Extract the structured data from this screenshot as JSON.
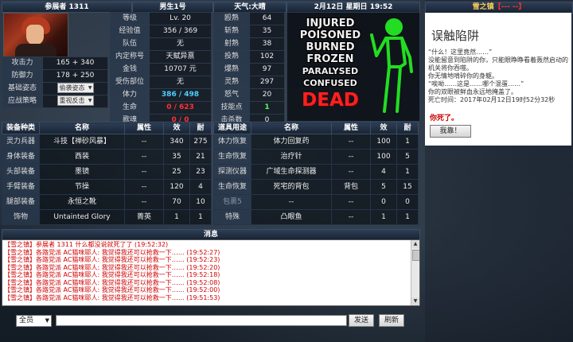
{
  "header": {
    "player": "参展者 1311",
    "server": "男生1号",
    "weather": "天气:大晴",
    "datetime": "2月12日 星期日 19:52"
  },
  "left_stats": [
    {
      "label": "攻击力",
      "value": "165 + 340"
    },
    {
      "label": "防御力",
      "value": "178 + 250"
    }
  ],
  "stance": {
    "label": "基础姿态",
    "value": "偷袭姿态"
  },
  "strategy": {
    "label": "应战策略",
    "value": "重视反击"
  },
  "stats_a": [
    {
      "label": "等级",
      "value": "Lv. 20"
    },
    {
      "label": "经验值",
      "value": "356 / 369"
    },
    {
      "label": "队伍",
      "value": "无"
    },
    {
      "label": "内定称号",
      "value": "天赋异禀"
    },
    {
      "label": "金钱",
      "value": "10707 元"
    },
    {
      "label": "受伤部位",
      "value": "无"
    },
    {
      "label": "体力",
      "value": "386 / 498",
      "style": "cyan"
    },
    {
      "label": "生命",
      "value": "0 / 623",
      "style": "red"
    },
    {
      "label": "歌魂",
      "value": "0 / 0",
      "style": "red"
    }
  ],
  "stats_b": [
    {
      "label": "殴熟",
      "value": "64"
    },
    {
      "label": "斩熟",
      "value": "35"
    },
    {
      "label": "射熟",
      "value": "38"
    },
    {
      "label": "投熟",
      "value": "102"
    },
    {
      "label": "爆熟",
      "value": "97"
    },
    {
      "label": "灵熟",
      "value": "297"
    },
    {
      "label": "怒气",
      "value": "20"
    },
    {
      "label": "技能点",
      "value": "1",
      "style": "green"
    },
    {
      "label": "击杀数",
      "value": "0"
    }
  ],
  "status_words": [
    "INJURED",
    "POISONED",
    "BURNED",
    "FROZEN",
    "PARALYSED",
    "CONFUSED"
  ],
  "dead_word": "DEAD",
  "equipment": {
    "headers": [
      "装备种类",
      "名称",
      "属性",
      "效",
      "耐"
    ],
    "rows": [
      {
        "cat": "灵力兵器",
        "name": "斗技【禅砂风暴】",
        "attr": "--",
        "eff": "340",
        "dur": "275"
      },
      {
        "cat": "身体装备",
        "name": "西装",
        "attr": "--",
        "eff": "35",
        "dur": "21"
      },
      {
        "cat": "头部装备",
        "name": "墨镜",
        "attr": "--",
        "eff": "25",
        "dur": "23"
      },
      {
        "cat": "手臂装备",
        "name": "节操",
        "attr": "--",
        "eff": "120",
        "dur": "4"
      },
      {
        "cat": "腿部装备",
        "name": "永恒之靴",
        "attr": "--",
        "eff": "70",
        "dur": "10"
      },
      {
        "cat": "饰物",
        "name": "Untainted Glory",
        "attr": "菁英",
        "eff": "1",
        "dur": "1"
      }
    ]
  },
  "items": {
    "headers": [
      "道具用途",
      "名称",
      "属性",
      "效",
      "耐"
    ],
    "rows": [
      {
        "cat": "体力恢复",
        "name": "体力回复药",
        "attr": "--",
        "eff": "100",
        "dur": "1",
        "dim": false
      },
      {
        "cat": "生命恢复",
        "name": "治疗针",
        "attr": "--",
        "eff": "100",
        "dur": "5",
        "dim": false
      },
      {
        "cat": "探测仪器",
        "name": "广域生命探测器",
        "attr": "--",
        "eff": "4",
        "dur": "1",
        "dim": false
      },
      {
        "cat": "生命恢复",
        "name": "死宅的背包",
        "attr": "背包",
        "eff": "5",
        "dur": "15",
        "dim": false
      },
      {
        "cat": "包裹5",
        "name": "--",
        "attr": "--",
        "eff": "0",
        "dur": "0",
        "dim": true
      },
      {
        "cat": "特殊",
        "name": "凸眼鱼",
        "attr": "--",
        "eff": "1",
        "dur": "1",
        "dim": false
      }
    ]
  },
  "messages": {
    "title": "消息",
    "lines": [
      {
        "text": "【雪之镇】参展者 1311 什么都没说就死了了 (19:52:32)"
      },
      {
        "text": "【雪之镇】各路党派 AC猫咪耶人: 我觉得我还可以抢救一下…… (19:52:27)"
      },
      {
        "text": "【雪之镇】各路党派 AC猫咪耶人: 我觉得我还可以抢救一下…… (19:52:23)"
      },
      {
        "text": "【雪之镇】各路党派 AC猫咪耶人: 我觉得我还可以抢救一下…… (19:52:20)"
      },
      {
        "text": "【雪之镇】各路党派 AC猫咪耶人: 我觉得我还可以抢救一下…… (19:52:18)"
      },
      {
        "text": "【雪之镇】各路党派 AC猫咪耶人: 我觉得我还可以抢救一下…… (19:52:08)"
      },
      {
        "text": "【雪之镇】各路党派 AC猫咪耶人: 我觉得我还可以抢救一下…… (19:52:00)"
      },
      {
        "text": "【雪之镇】各路党派 AC猫咪耶人: 我觉得我还可以抢救一下…… (19:51:53)"
      }
    ],
    "channel": "全员",
    "input_value": "",
    "send_label": "发送",
    "refresh_label": "刷新"
  },
  "side": {
    "location": "雪之镇",
    "status_tag": "【--- --】",
    "event_title": "误触陷阱",
    "paragraphs": [
      "“什么！这里竟然……”",
      "没能留意到陷阱的你，只能眼睁睁看着轰然启动的机关将你吞噬。",
      "你无情地啃碎你的身躯。",
      "“唉呦……这是……哪个混蛋……”",
      "你的双眼被鲜血永远地掩盖了。",
      "死亡时间：2017年02月12日19时52分32秒"
    ],
    "died_text": "你死了。",
    "revive_label": "我靠！"
  },
  "colors": {
    "dead": "#ff2020",
    "hp": "#ff3030",
    "stamina": "#4fd0ff",
    "message": "#d00000",
    "figure": "#22dd22"
  }
}
